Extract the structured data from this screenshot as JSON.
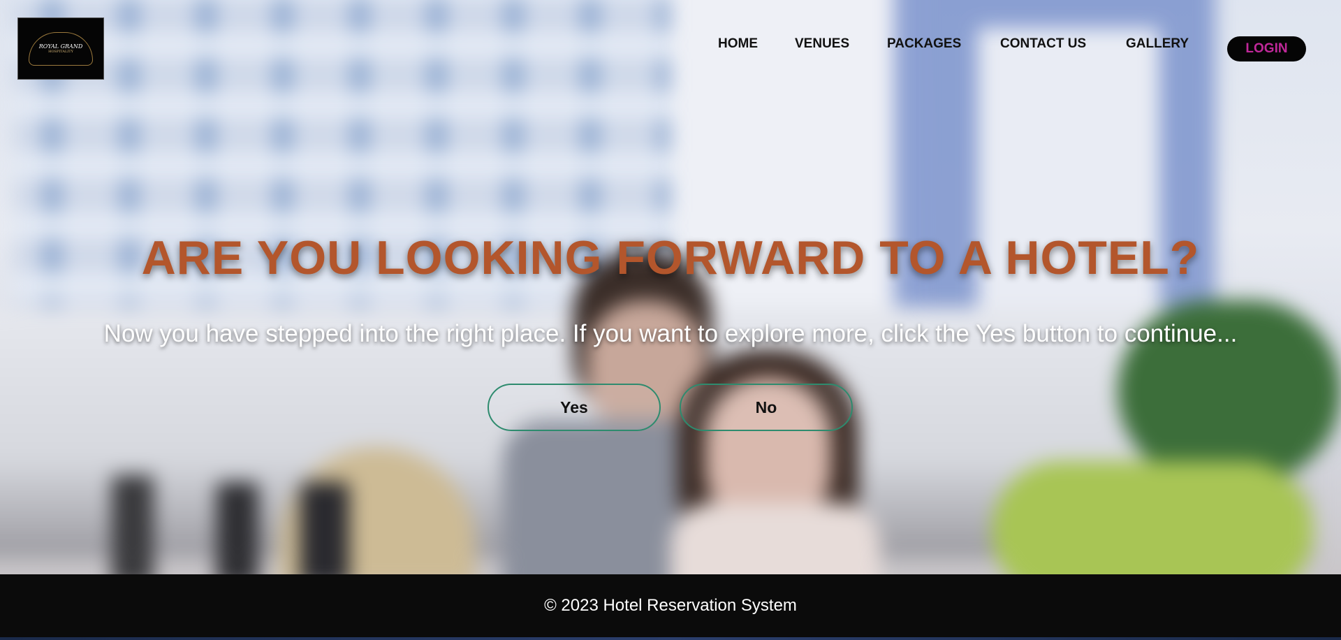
{
  "brand": {
    "logo_title": "ROYAL GRAND",
    "logo_subtitle": "HOSPITALITY"
  },
  "nav": {
    "items": [
      {
        "label": "HOME"
      },
      {
        "label": "VENUES"
      },
      {
        "label": "PACKAGES"
      },
      {
        "label": "CONTACT US"
      },
      {
        "label": "GALLERY"
      }
    ],
    "login_label": "LOGIN"
  },
  "hero": {
    "headline": "ARE YOU LOOKING FORWARD TO A HOTEL?",
    "subtext": "Now you have stepped into the right place. If you want to explore more, click the Yes button to continue...",
    "yes_label": "Yes",
    "no_label": "No"
  },
  "footer": {
    "text": "© 2023 Hotel Reservation System"
  },
  "colors": {
    "headline": "#b3562c",
    "login_text": "#c0289a",
    "button_border": "#2e8b6e",
    "footer_bg": "#0b0b0b"
  }
}
